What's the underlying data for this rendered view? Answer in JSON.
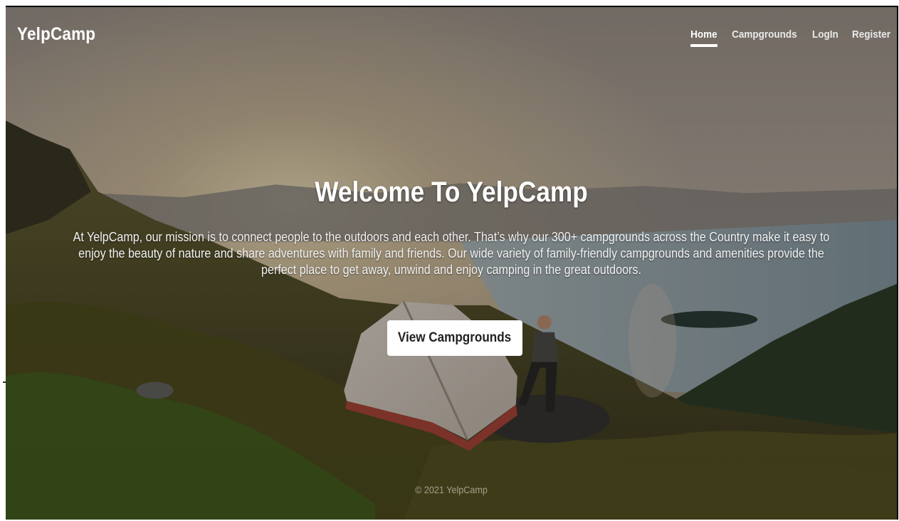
{
  "navbar": {
    "brand": "YelpCamp",
    "links": [
      {
        "label": "Home",
        "active": true
      },
      {
        "label": "Campgrounds",
        "active": false
      },
      {
        "label": "LogIn",
        "active": false
      },
      {
        "label": "Register",
        "active": false
      }
    ]
  },
  "hero": {
    "title": "Welcome To YelpCamp",
    "description": "At YelpCamp, our mission is to connect people to the outdoors and each other. That’s why our 300+ campgrounds across the Country make it easy to enjoy the beauty of nature and share adventures with family and friends. Our wide variety of family-friendly campgrounds and amenities provide the perfect place to get away, unwind and enjoy camping in the great outdoors.",
    "cta_label": "View Campgrounds"
  },
  "footer": {
    "text": "© 2021 YelpCamp"
  },
  "colors": {
    "overlay": "#000000",
    "text": "#ffffff",
    "button_bg": "#ffffff",
    "button_text": "#222222"
  }
}
